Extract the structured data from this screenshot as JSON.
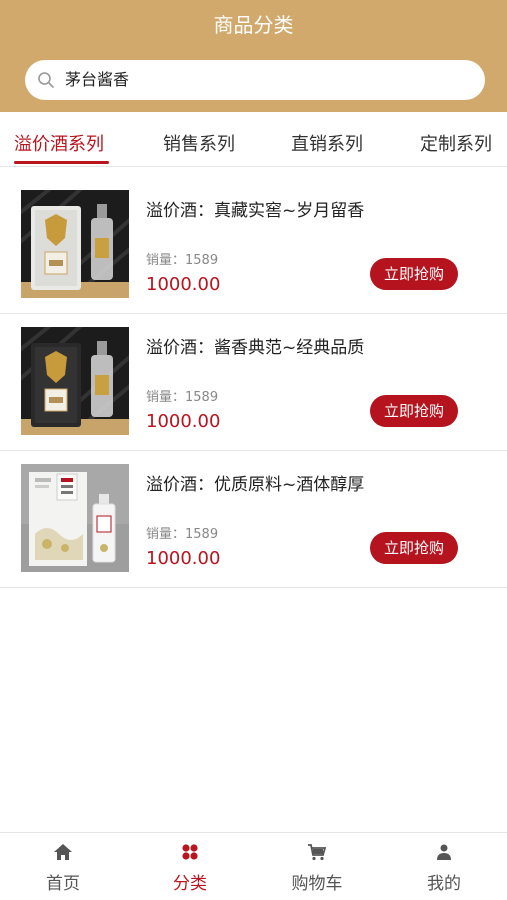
{
  "header": {
    "title": "商品分类"
  },
  "search": {
    "value": "茅台酱香",
    "icon": "search-icon"
  },
  "tabs": [
    {
      "label": "溢价酒系列",
      "active": true
    },
    {
      "label": "销售系列",
      "active": false
    },
    {
      "label": "直销系列",
      "active": false
    },
    {
      "label": "定制系列",
      "active": false
    }
  ],
  "products": [
    {
      "name": "溢价酒：真藏实窖~岁月留香",
      "sales_label": "销量：1589",
      "price": "1000.00",
      "button": "立即抢购"
    },
    {
      "name": "溢价酒：酱香典范~经典品质",
      "sales_label": "销量：1589",
      "price": "1000.00",
      "button": "立即抢购"
    },
    {
      "name": "溢价酒：优质原料~酒体醇厚",
      "sales_label": "销量：1589",
      "price": "1000.00",
      "button": "立即抢购"
    }
  ],
  "tabbar": [
    {
      "label": "首页",
      "icon": "home-icon",
      "active": false
    },
    {
      "label": "分类",
      "icon": "category-icon",
      "active": true
    },
    {
      "label": "购物车",
      "icon": "cart-icon",
      "active": false
    },
    {
      "label": "我的",
      "icon": "user-icon",
      "active": false
    }
  ],
  "colors": {
    "header": "#d2a96c",
    "accent": "#b8151f"
  }
}
